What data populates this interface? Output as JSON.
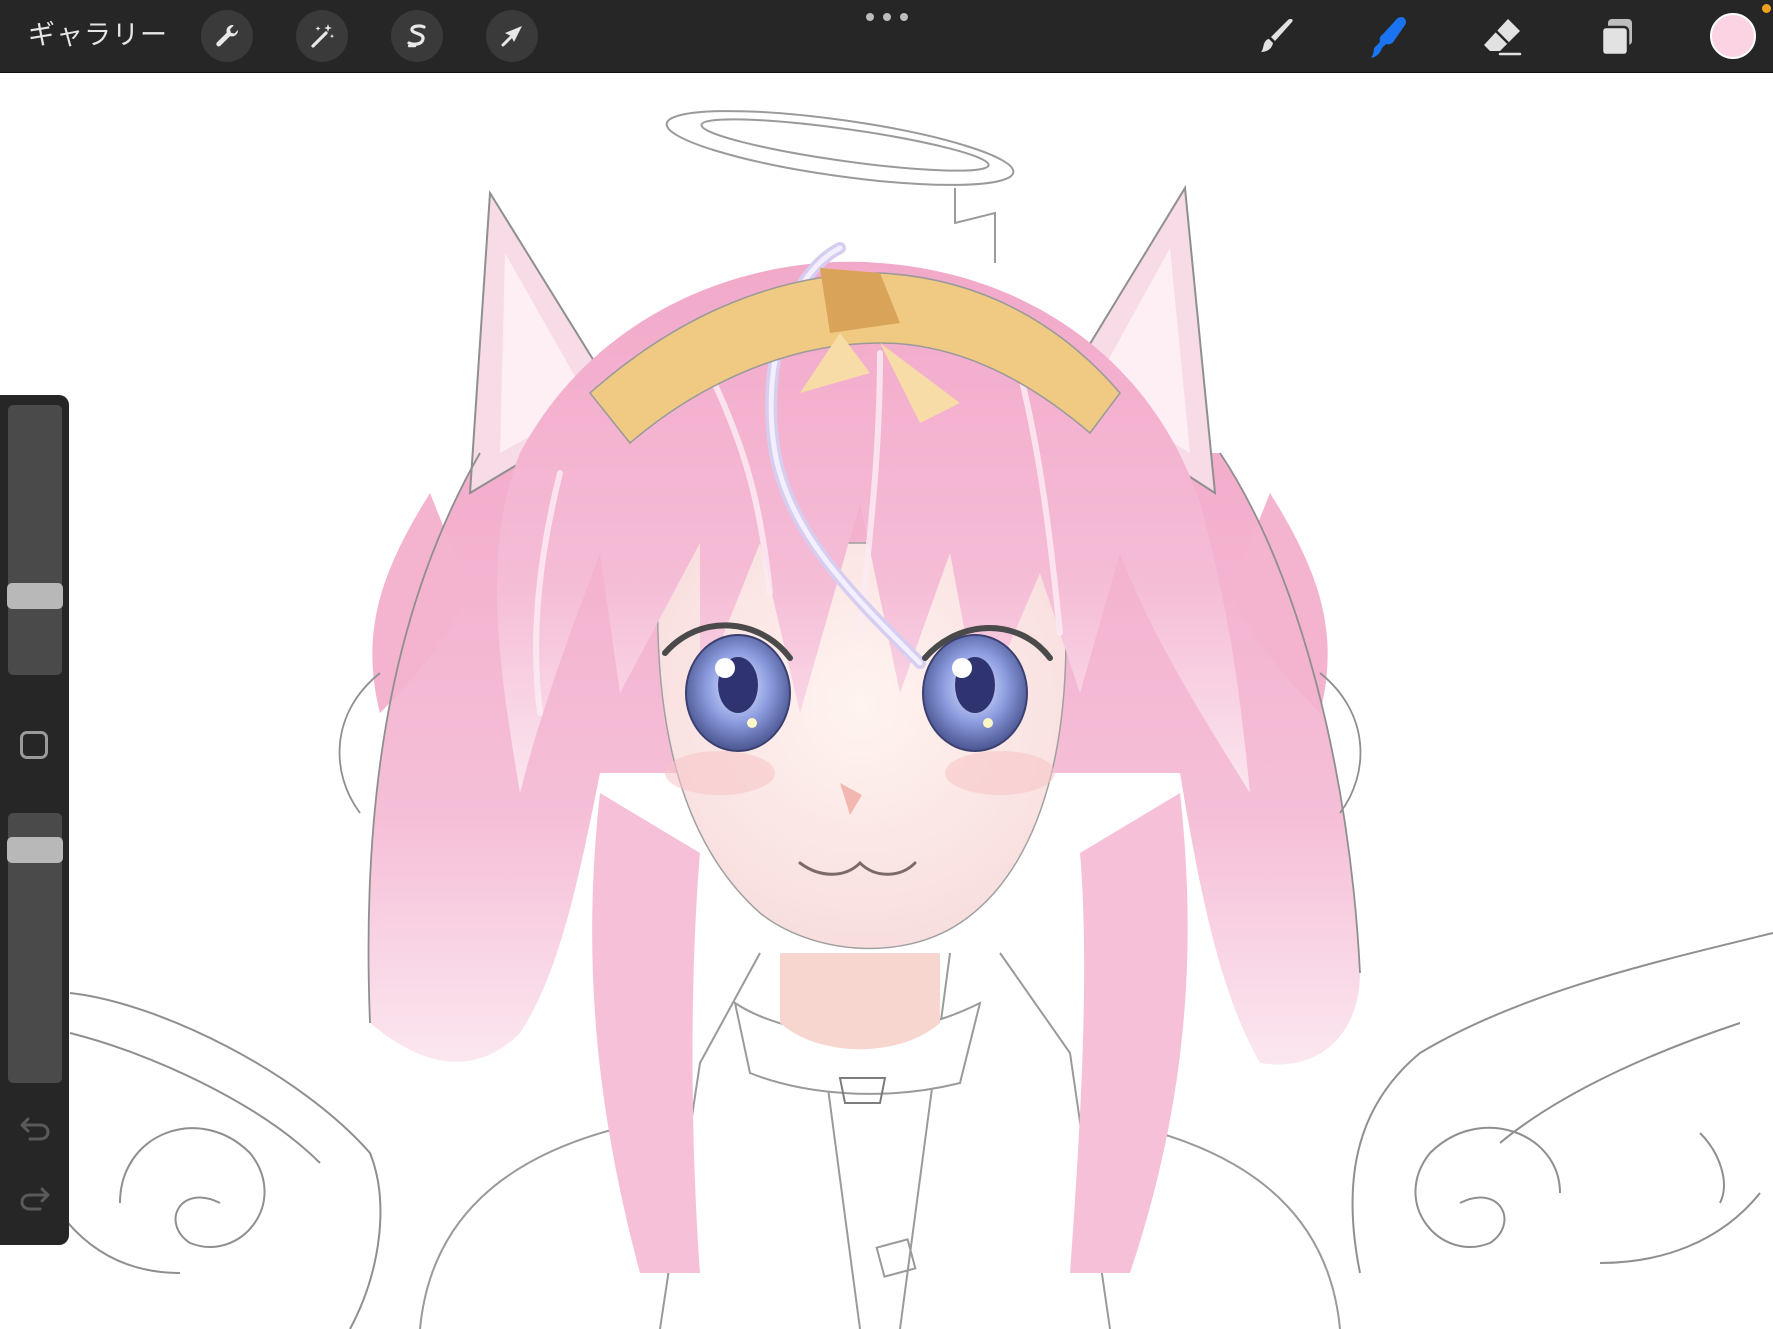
{
  "toolbar": {
    "gallery_label": "ギャラリー",
    "left_tools": [
      {
        "name": "actions",
        "icon": "wrench-icon"
      },
      {
        "name": "adjustments",
        "icon": "magic-wand-icon"
      },
      {
        "name": "selection",
        "icon": "selection-s-icon"
      },
      {
        "name": "transform",
        "icon": "arrow-cursor-icon"
      }
    ],
    "more_icon": "ellipsis-icon",
    "right_tools": [
      {
        "name": "brush",
        "icon": "brush-icon",
        "active": false
      },
      {
        "name": "smudge",
        "icon": "smudge-finger-icon",
        "active": true
      },
      {
        "name": "eraser",
        "icon": "eraser-icon",
        "active": false
      },
      {
        "name": "layers",
        "icon": "layers-icon",
        "active": false
      }
    ],
    "current_color": "#fcd3e3",
    "accent_color": "#1a73f0",
    "notification_color": "#f0a020"
  },
  "sidebar": {
    "brush_size_level": 0.27,
    "opacity_level": 0.9,
    "modify_icon": "square-icon",
    "undo_icon": "undo-icon",
    "redo_icon": "redo-icon"
  },
  "canvas": {
    "content": "artwork-illustration"
  }
}
